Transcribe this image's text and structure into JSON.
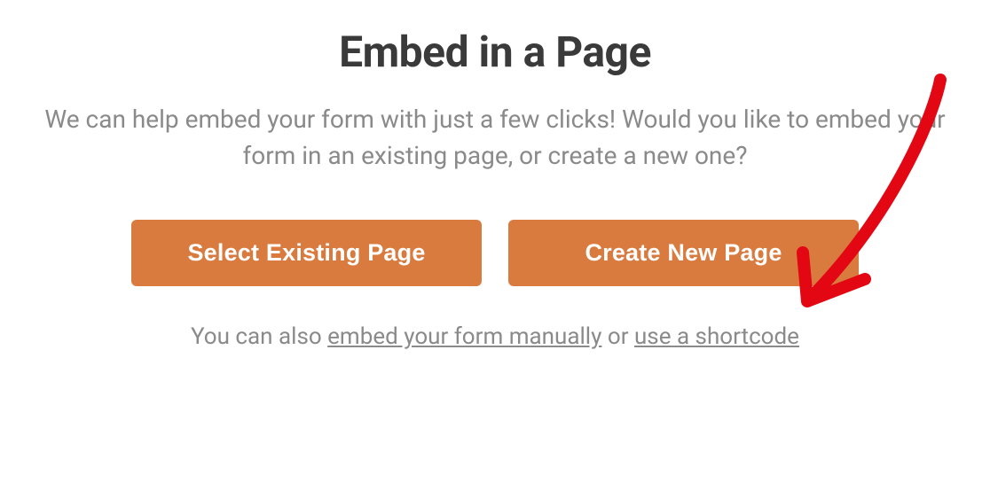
{
  "dialog": {
    "title": "Embed in a Page",
    "description": "We can help embed your form with just a few clicks! Would you like to embed your form in an existing page, or create a new one?",
    "buttons": {
      "select_existing": "Select Existing Page",
      "create_new": "Create New Page"
    },
    "footer": {
      "prefix": "You can also ",
      "link_manual": "embed your form manually",
      "middle": " or ",
      "link_shortcode": "use a shortcode"
    }
  },
  "annotation": {
    "type": "arrow",
    "color": "#e30613",
    "target": "create-new-page-button"
  }
}
